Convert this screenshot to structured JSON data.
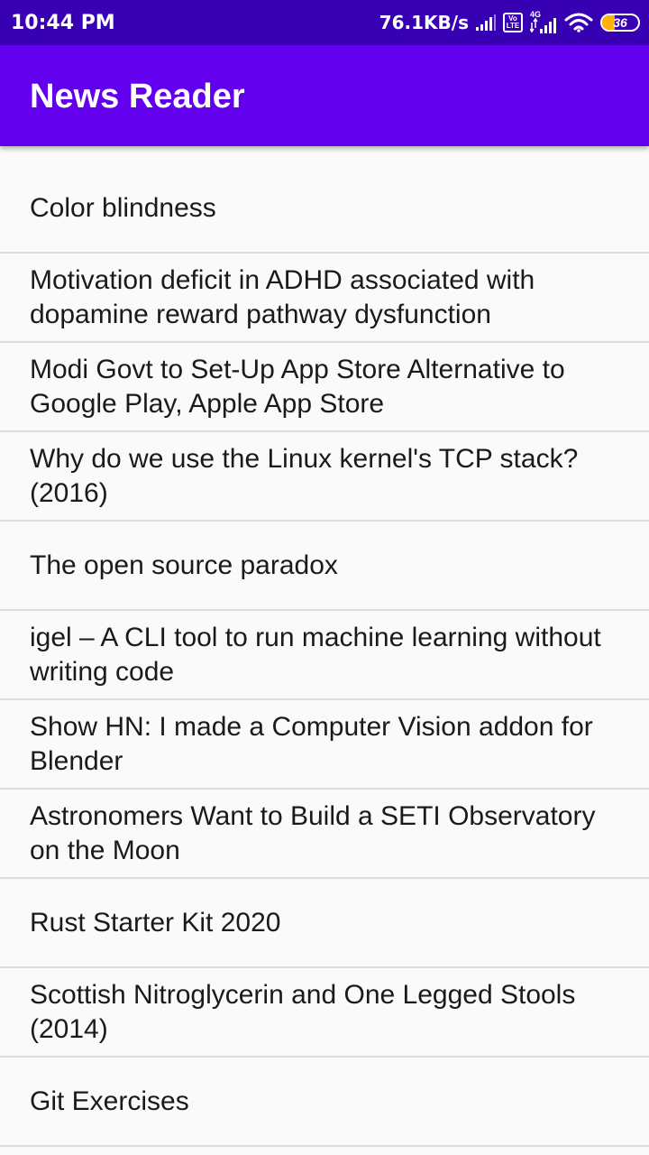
{
  "status_bar": {
    "time": "10:44 PM",
    "network_speed": "76.1KB/s",
    "volte_top": "Vo",
    "volte_bottom": "LTE",
    "network_type": "4G",
    "battery_level": "36",
    "battery_fraction": 0.36,
    "battery_color": "#ffb300",
    "icons": [
      "signal-icon",
      "volte-icon",
      "4g-signal-icon",
      "wifi-icon",
      "battery-icon"
    ]
  },
  "app_bar": {
    "title": "News Reader",
    "color": "#6200ee"
  },
  "news": {
    "items": [
      {
        "title": "Color blindness"
      },
      {
        "title": "Motivation deficit in ADHD associated with dopamine reward pathway dysfunction"
      },
      {
        "title": "Modi Govt to Set-Up App Store Alternative to Google Play, Apple App Store"
      },
      {
        "title": "Why do we use the Linux kernel's TCP stack? (2016)"
      },
      {
        "title": "The open source paradox"
      },
      {
        "title": "igel – A CLI tool to run machine learning without writing code"
      },
      {
        "title": "Show HN: I made a Computer Vision addon for Blender"
      },
      {
        "title": "Astronomers Want to Build a SETI Observatory on the Moon"
      },
      {
        "title": "Rust Starter Kit 2020"
      },
      {
        "title": "Scottish Nitroglycerin and One Legged Stools (2014)"
      },
      {
        "title": "Git Exercises"
      }
    ]
  }
}
